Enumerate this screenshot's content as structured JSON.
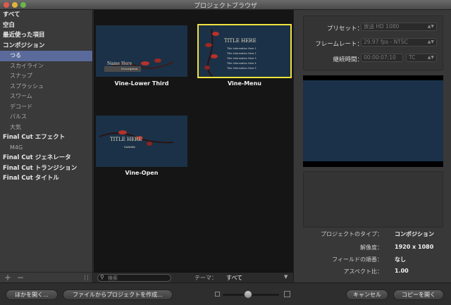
{
  "window": {
    "title": "プロジェクトブラウザ"
  },
  "sidebar": {
    "items": [
      {
        "label": "すべて",
        "level": 0
      },
      {
        "label": "空白",
        "level": 0
      },
      {
        "label": "最近使った項目",
        "level": 0
      },
      {
        "label": "コンポジション",
        "level": 0
      },
      {
        "label": "つる",
        "level": 1,
        "selected": true
      },
      {
        "label": "スカイライン",
        "level": 1
      },
      {
        "label": "スナップ",
        "level": 1
      },
      {
        "label": "スプラッシュ",
        "level": 1
      },
      {
        "label": "スワーム",
        "level": 1
      },
      {
        "label": "デコード",
        "level": 1
      },
      {
        "label": "パルス",
        "level": 1
      },
      {
        "label": "大気",
        "level": 1
      },
      {
        "label": "Final Cut エフェクト",
        "level": 0
      },
      {
        "label": "M4G",
        "level": 1
      },
      {
        "label": "Final Cut ジェネレータ",
        "level": 0
      },
      {
        "label": "Final Cut トランジション",
        "level": 0
      },
      {
        "label": "Final Cut タイトル",
        "level": 0
      }
    ],
    "add_label": "+",
    "remove_label": "−"
  },
  "browser": {
    "templates": [
      {
        "name": "Vine-Lower Third",
        "thumb_title": "Name Here",
        "thumb_sub": "Description"
      },
      {
        "name": "Vine-Menu",
        "thumb_title": "TITLE HERE",
        "selected": true,
        "menu_items": [
          "Title Information Here 1",
          "Title Information Here 2",
          "Title Information Here 3",
          "Title Information Here 4",
          "Title Information Here 5"
        ]
      },
      {
        "name": "Vine-Open",
        "thumb_title": "TITLE HERE",
        "thumb_sub": "Subtitle"
      }
    ],
    "search_placeholder": "検索",
    "theme_label": "テーマ：",
    "theme_value": "すべて"
  },
  "settings": {
    "preset_label": "プリセット：",
    "preset_value": "放送 HD 1080",
    "framerate_label": "フレームレート：",
    "framerate_value": "29.97 fps - NTSC",
    "duration_label": "継続時間：",
    "duration_value": "00:00:07;10",
    "duration_unit": "TC"
  },
  "info": {
    "type_label": "プロジェクトのタイプ：",
    "type_value": "コンポジション",
    "resolution_label": "解像度：",
    "resolution_value": "1920 x 1080",
    "field_label": "フィールドの順番：",
    "field_value": "なし",
    "aspect_label": "アスペクト比：",
    "aspect_value": "1.00"
  },
  "footer": {
    "open_other": "ほかを開く...",
    "create_from_file": "ファイルからプロジェクトを作成...",
    "cancel": "キャンセル",
    "open_copy": "コピーを開く",
    "zoom_level": 0.45
  },
  "colors": {
    "selection_outline": "#f1e33c",
    "sidebar_selection": "#5a6a9a"
  }
}
